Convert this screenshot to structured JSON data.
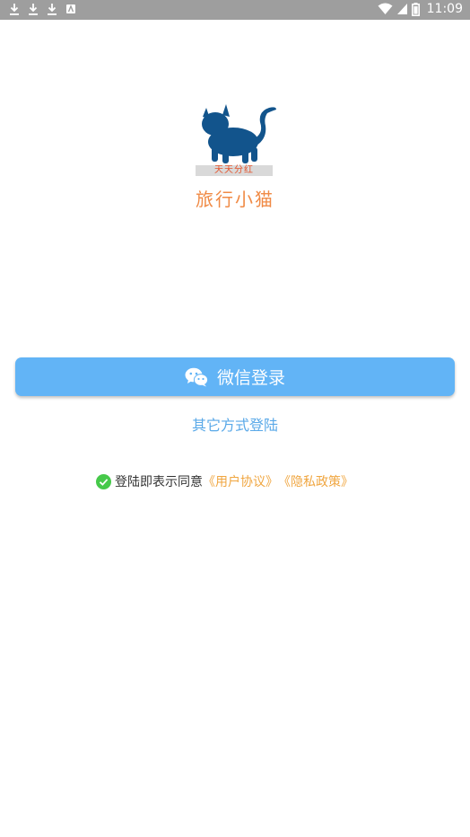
{
  "status_bar": {
    "time": "11:09",
    "left_icons": [
      "download-icon",
      "download-icon",
      "download-icon",
      "app-notification-icon"
    ],
    "right_icons": [
      "wifi-icon",
      "signal-icon",
      "battery-icon"
    ]
  },
  "brand": {
    "banner_text": "天天分红",
    "app_name": "旅行小猫",
    "colors": {
      "cat": "#12548c",
      "name": "#f08a45",
      "banner_text": "#e4532b"
    }
  },
  "login": {
    "wechat_button_label": "微信登录",
    "wechat_icon": "wechat-icon",
    "other_methods_label": "其它方式登陆",
    "colors": {
      "button": "#62b4f6",
      "link": "#5aa9e8"
    }
  },
  "agreement": {
    "text": "登陆即表示同意",
    "user_agreement": "《用户协议》",
    "privacy_policy": "《隐私政策》",
    "check_icon": "check-circle-icon",
    "colors": {
      "check": "#46c94a",
      "link": "#f0a640"
    }
  }
}
